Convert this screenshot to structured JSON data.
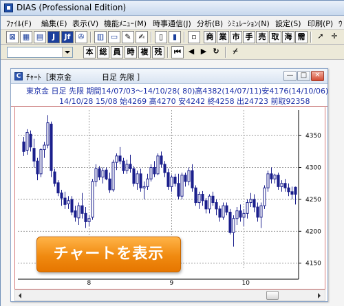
{
  "app": {
    "title": "DIAS (Professional Edition)"
  },
  "menu": [
    "ﾌｧｲﾙ(F)",
    "編集(E)",
    "表示(V)",
    "機能ﾒﾆｭｰ(M)",
    "時事通信(J)",
    "分析(B)",
    "ｼﾐｭﾚｰｼｮﾝ(N)",
    "設定(S)",
    "印刷(P)",
    "ｳ"
  ],
  "toolbar1": {
    "kanji_buttons": [
      "商",
      "業",
      "市",
      "手",
      "売",
      "取",
      "海",
      "需"
    ]
  },
  "toolbar2": {
    "dropdown_value": "",
    "kanji_buttons": [
      "本",
      "総",
      "員",
      "時",
      "複",
      "残"
    ]
  },
  "chart_window": {
    "title": "ﾁｬｰﾄ［東京金　　　　日足 先限 ］",
    "info_line1": "東京金 日足 先限 期間14/07/03～14/10/28( 80)高4382(14/07/11)安4176(14/10/06)",
    "info_line2": "14/10/28 15/08 始4269 高4270 安4242 終4258 出24723 前取92358",
    "minimize_glyph": "—",
    "maximize_glyph": "□",
    "close_glyph": "✕"
  },
  "cta": {
    "label": "チャートを表示"
  },
  "colors": {
    "candle": "#1b1f8c",
    "grid": "#9a9a9a",
    "axis_text": "#000000",
    "cta": "#f08a10"
  },
  "chart_data": {
    "type": "candlestick",
    "title": "",
    "xlabel": "",
    "ylabel": "",
    "ylim": [
      4140,
      4390
    ],
    "y_ticks": [
      "4350",
      "4300",
      "4250",
      "4200",
      "4150"
    ],
    "x_tick_labels": [
      "8",
      "9",
      "10"
    ],
    "x_tick_index": [
      19,
      43,
      64
    ],
    "candles": [
      [
        4340,
        4348,
        4318,
        4325
      ],
      [
        4327,
        4360,
        4320,
        4355
      ],
      [
        4352,
        4358,
        4325,
        4332
      ],
      [
        4330,
        4345,
        4300,
        4310
      ],
      [
        4310,
        4315,
        4280,
        4290
      ],
      [
        4290,
        4330,
        4285,
        4328
      ],
      [
        4328,
        4340,
        4315,
        4335
      ],
      [
        4335,
        4382,
        4330,
        4370
      ],
      [
        4368,
        4372,
        4285,
        4295
      ],
      [
        4293,
        4298,
        4270,
        4275
      ],
      [
        4276,
        4280,
        4255,
        4260
      ],
      [
        4260,
        4265,
        4240,
        4252
      ],
      [
        4252,
        4262,
        4235,
        4242
      ],
      [
        4243,
        4255,
        4235,
        4248
      ],
      [
        4250,
        4255,
        4225,
        4230
      ],
      [
        4232,
        4240,
        4215,
        4222
      ],
      [
        4221,
        4245,
        4210,
        4240
      ],
      [
        4240,
        4260,
        4220,
        4228
      ],
      [
        4228,
        4238,
        4205,
        4215
      ],
      [
        4215,
        4225,
        4208,
        4220
      ],
      [
        4222,
        4282,
        4218,
        4278
      ],
      [
        4278,
        4305,
        4270,
        4298
      ],
      [
        4298,
        4302,
        4280,
        4285
      ],
      [
        4285,
        4300,
        4275,
        4295
      ],
      [
        4296,
        4300,
        4280,
        4282
      ],
      [
        4282,
        4292,
        4260,
        4265
      ],
      [
        4265,
        4312,
        4262,
        4308
      ],
      [
        4308,
        4322,
        4296,
        4318
      ],
      [
        4318,
        4332,
        4305,
        4310
      ],
      [
        4310,
        4315,
        4290,
        4295
      ],
      [
        4295,
        4312,
        4290,
        4305
      ],
      [
        4305,
        4320,
        4292,
        4298
      ],
      [
        4298,
        4302,
        4270,
        4275
      ],
      [
        4275,
        4295,
        4265,
        4290
      ],
      [
        4290,
        4298,
        4262,
        4268
      ],
      [
        4268,
        4278,
        4250,
        4270
      ],
      [
        4270,
        4290,
        4265,
        4282
      ],
      [
        4282,
        4305,
        4278,
        4300
      ],
      [
        4300,
        4310,
        4285,
        4290
      ],
      [
        4290,
        4322,
        4288,
        4318
      ],
      [
        4318,
        4325,
        4300,
        4305
      ],
      [
        4305,
        4310,
        4285,
        4292
      ],
      [
        4292,
        4298,
        4265,
        4270
      ],
      [
        4270,
        4288,
        4262,
        4285
      ],
      [
        4285,
        4290,
        4270,
        4275
      ],
      [
        4275,
        4290,
        4250,
        4255
      ],
      [
        4255,
        4292,
        4250,
        4288
      ],
      [
        4288,
        4292,
        4270,
        4278
      ],
      [
        4278,
        4300,
        4272,
        4295
      ],
      [
        4295,
        4305,
        4262,
        4268
      ],
      [
        4268,
        4272,
        4240,
        4245
      ],
      [
        4245,
        4262,
        4235,
        4258
      ],
      [
        4258,
        4263,
        4240,
        4248
      ],
      [
        4248,
        4252,
        4228,
        4235
      ],
      [
        4235,
        4258,
        4228,
        4255
      ],
      [
        4255,
        4262,
        4240,
        4245
      ],
      [
        4245,
        4250,
        4225,
        4235
      ],
      [
        4235,
        4240,
        4215,
        4222
      ],
      [
        4222,
        4245,
        4218,
        4240
      ],
      [
        4240,
        4245,
        4225,
        4230
      ],
      [
        4230,
        4235,
        4195,
        4198
      ],
      [
        4198,
        4225,
        4176,
        4220
      ],
      [
        4220,
        4238,
        4210,
        4232
      ],
      [
        4232,
        4242,
        4215,
        4222
      ],
      [
        4222,
        4235,
        4208,
        4228
      ],
      [
        4228,
        4250,
        4220,
        4245
      ],
      [
        4245,
        4260,
        4238,
        4250
      ],
      [
        4250,
        4258,
        4230,
        4238
      ],
      [
        4238,
        4245,
        4215,
        4222
      ],
      [
        4222,
        4245,
        4205,
        4240
      ],
      [
        4240,
        4272,
        4235,
        4268
      ],
      [
        4268,
        4295,
        4262,
        4290
      ],
      [
        4290,
        4300,
        4275,
        4282
      ],
      [
        4282,
        4290,
        4275,
        4288
      ],
      [
        4288,
        4292,
        4265,
        4270
      ],
      [
        4270,
        4280,
        4262,
        4275
      ],
      [
        4275,
        4282,
        4262,
        4268
      ],
      [
        4268,
        4275,
        4255,
        4262
      ],
      [
        4262,
        4270,
        4250,
        4258
      ],
      [
        4269,
        4270,
        4242,
        4258
      ]
    ]
  }
}
